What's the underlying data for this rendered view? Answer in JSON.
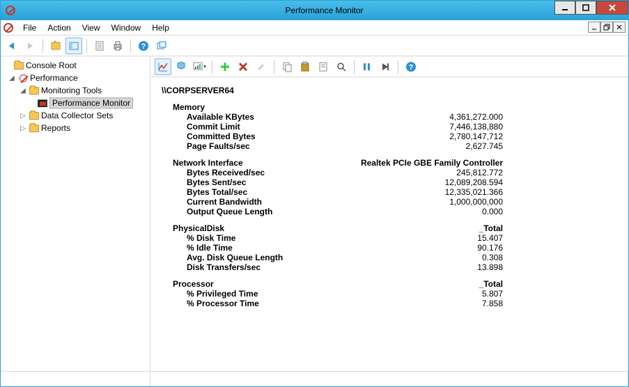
{
  "window": {
    "title": "Performance Monitor"
  },
  "menus": {
    "file": "File",
    "action": "Action",
    "view": "View",
    "window": "Window",
    "help": "Help"
  },
  "tree": {
    "root": "Console Root",
    "perf": "Performance",
    "montools": "Monitoring Tools",
    "perfmon": "Performance Monitor",
    "dcs": "Data Collector Sets",
    "reports": "Reports"
  },
  "report": {
    "host": "\\\\CORPSERVER64",
    "groups": [
      {
        "name": "Memory",
        "instance": "",
        "rows": [
          {
            "label": "Available KBytes",
            "value": "4,361,272.000"
          },
          {
            "label": "Commit Limit",
            "value": "7,446,138,880"
          },
          {
            "label": "Committed Bytes",
            "value": "2,780,147,712"
          },
          {
            "label": "Page Faults/sec",
            "value": "2,627.745"
          }
        ]
      },
      {
        "name": "Network Interface",
        "instance": "Realtek PCIe GBE Family Controller",
        "rows": [
          {
            "label": "Bytes Received/sec",
            "value": "245,812.772"
          },
          {
            "label": "Bytes Sent/sec",
            "value": "12,089,208.594"
          },
          {
            "label": "Bytes Total/sec",
            "value": "12,335,021.366"
          },
          {
            "label": "Current Bandwidth",
            "value": "1,000,000,000"
          },
          {
            "label": "Output Queue Length",
            "value": "0.000"
          }
        ]
      },
      {
        "name": "PhysicalDisk",
        "instance": "_Total",
        "rows": [
          {
            "label": "% Disk Time",
            "value": "15.407"
          },
          {
            "label": "% Idle Time",
            "value": "90.176"
          },
          {
            "label": "Avg. Disk Queue Length",
            "value": "0.308"
          },
          {
            "label": "Disk Transfers/sec",
            "value": "13.898"
          }
        ]
      },
      {
        "name": "Processor",
        "instance": "_Total",
        "rows": [
          {
            "label": "% Privileged Time",
            "value": "5.807"
          },
          {
            "label": "% Processor Time",
            "value": "7.858"
          }
        ]
      }
    ]
  }
}
